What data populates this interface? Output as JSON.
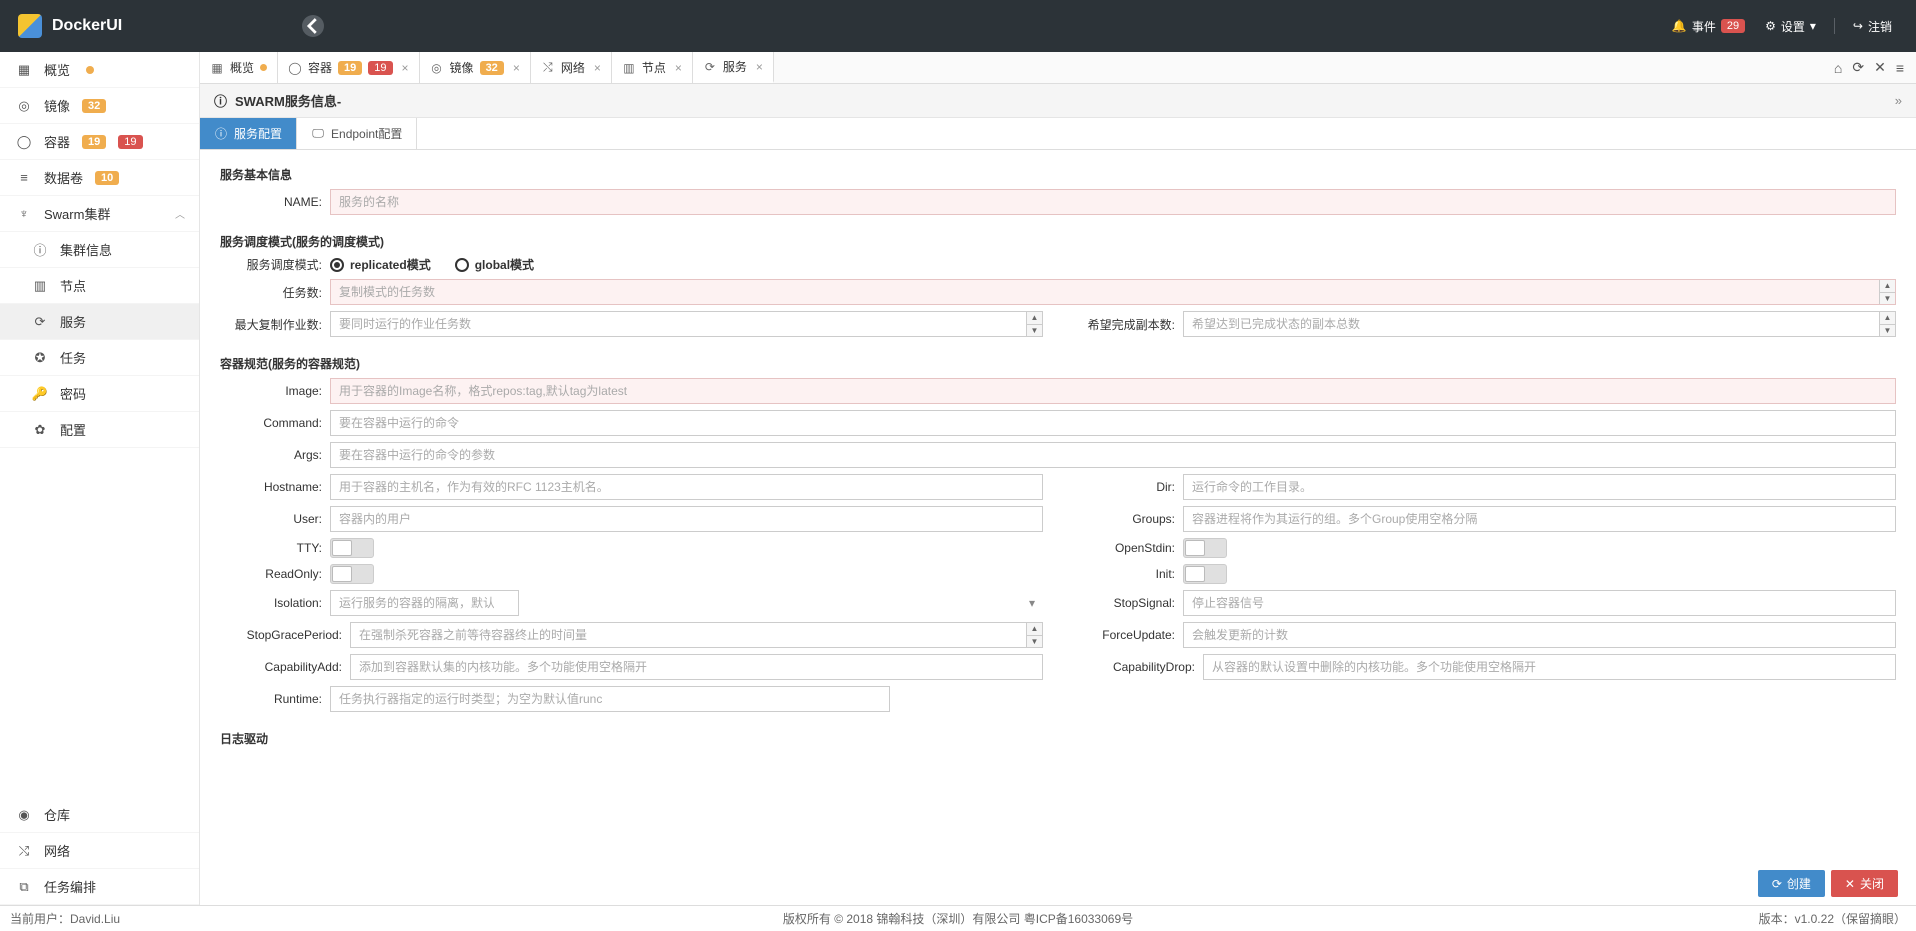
{
  "app": {
    "name": "DockerUI"
  },
  "topbar": {
    "events_label": "事件",
    "events_count": "29",
    "settings_label": "设置",
    "logout_label": "注销"
  },
  "sidebar": {
    "items": [
      {
        "label": "概览",
        "icon": "dashboard"
      },
      {
        "label": "镜像",
        "icon": "image",
        "badge": "32"
      },
      {
        "label": "容器",
        "icon": "container",
        "badges": [
          "19",
          "19"
        ]
      },
      {
        "label": "数据卷",
        "icon": "volume",
        "badge": "10"
      },
      {
        "label": "Swarm集群",
        "icon": "swarm",
        "expandable": true
      },
      {
        "label": "集群信息",
        "icon": "info",
        "sub": true
      },
      {
        "label": "节点",
        "icon": "node",
        "sub": true
      },
      {
        "label": "服务",
        "icon": "service",
        "sub": true,
        "active": true
      },
      {
        "label": "任务",
        "icon": "task",
        "sub": true
      },
      {
        "label": "密码",
        "icon": "secret",
        "sub": true
      },
      {
        "label": "配置",
        "icon": "config",
        "sub": true
      }
    ],
    "bottom": [
      {
        "label": "仓库",
        "icon": "registry"
      },
      {
        "label": "网络",
        "icon": "network"
      },
      {
        "label": "任务编排",
        "icon": "orchestration"
      }
    ]
  },
  "tabs": [
    {
      "label": "概览",
      "dot": true
    },
    {
      "label": "容器",
      "badges": [
        "19",
        "19"
      ]
    },
    {
      "label": "镜像",
      "badges_orange": [
        "32"
      ]
    },
    {
      "label": "网络"
    },
    {
      "label": "节点"
    },
    {
      "label": "服务",
      "active": true
    }
  ],
  "crumb": {
    "title": "SWARM服务信息-"
  },
  "subtabs": [
    {
      "label": "服务配置",
      "active": true
    },
    {
      "label": "Endpoint配置"
    }
  ],
  "form": {
    "section_basic": "服务基本信息",
    "name_label": "NAME:",
    "name_placeholder": "服务的名称",
    "section_mode": "服务调度模式(服务的调度模式)",
    "mode_label": "服务调度模式:",
    "mode_replicated": "replicated模式",
    "mode_global": "global模式",
    "tasks_label": "任务数:",
    "tasks_placeholder": "复制模式的任务数",
    "maxrepl_label": "最大复制作业数:",
    "maxrepl_placeholder": "要同时运行的作业任务数",
    "desired_label": "希望完成副本数:",
    "desired_placeholder": "希望达到已完成状态的副本总数",
    "section_spec": "容器规范(服务的容器规范)",
    "image_label": "Image:",
    "image_placeholder": "用于容器的Image名称，格式repos:tag,默认tag为latest",
    "command_label": "Command:",
    "command_placeholder": "要在容器中运行的命令",
    "args_label": "Args:",
    "args_placeholder": "要在容器中运行的命令的参数",
    "hostname_label": "Hostname:",
    "hostname_placeholder": "用于容器的主机名，作为有效的RFC 1123主机名。",
    "dir_label": "Dir:",
    "dir_placeholder": "运行命令的工作目录。",
    "user_label": "User:",
    "user_placeholder": "容器内的用户",
    "groups_label": "Groups:",
    "groups_placeholder": "容器进程将作为其运行的组。多个Group使用空格分隔",
    "tty_label": "TTY:",
    "openstdin_label": "OpenStdin:",
    "readonly_label": "ReadOnly:",
    "init_label": "Init:",
    "isolation_label": "Isolation:",
    "isolation_placeholder": "运行服务的容器的隔离，默认为空",
    "stopsignal_label": "StopSignal:",
    "stopsignal_placeholder": "停止容器信号",
    "stopgrace_label": "StopGracePeriod:",
    "stopgrace_placeholder": "在强制杀死容器之前等待容器终止的时间量",
    "forceupdate_label": "ForceUpdate:",
    "forceupdate_placeholder": "会触发更新的计数",
    "capadd_label": "CapabilityAdd:",
    "capadd_placeholder": "添加到容器默认集的内核功能。多个功能使用空格隔开",
    "capdrop_label": "CapabilityDrop:",
    "capdrop_placeholder": "从容器的默认设置中删除的内核功能。多个功能使用空格隔开",
    "runtime_label": "Runtime:",
    "runtime_placeholder": "任务执行器指定的运行时类型；为空为默认值runc",
    "section_log": "日志驱动"
  },
  "actions": {
    "create": "创建",
    "close": "关闭"
  },
  "footer": {
    "user_prefix": "当前用户：",
    "user_name": "David.Liu",
    "copyright": "版权所有 © 2018 锦翰科技（深圳）有限公司 粤ICP备16033069号",
    "version": "版本：v1.0.22（保留摘眼）"
  }
}
